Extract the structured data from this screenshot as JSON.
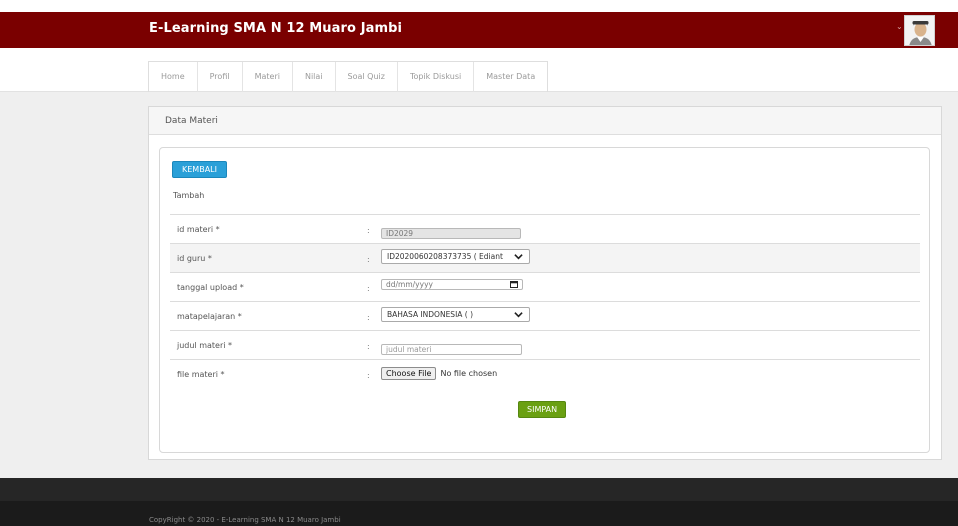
{
  "header": {
    "brand": "E-Learning SMA N 12 Muaro Jambi",
    "user_caret": "⌄"
  },
  "nav": {
    "items": [
      {
        "label": "Home"
      },
      {
        "label": "Profil"
      },
      {
        "label": "Materi"
      },
      {
        "label": "Nilai"
      },
      {
        "label": "Soal Quiz"
      },
      {
        "label": "Topik Diskusi"
      },
      {
        "label": "Master Data"
      }
    ]
  },
  "panel": {
    "title": "Data Materi",
    "back_button": "KEMBALI",
    "subtitle": "Tambah"
  },
  "form": {
    "colon": ":",
    "id_materi": {
      "label": "id materi *",
      "value": "ID2029"
    },
    "id_guru": {
      "label": "id guru *",
      "value": "ID2020060208373735 ( Ediant"
    },
    "tanggal_upload": {
      "label": "tanggal upload *",
      "placeholder": "dd/mm/yyyy"
    },
    "matapelajaran": {
      "label": "matapelajaran *",
      "value": "BAHASA INDONESIA ( )"
    },
    "judul_materi": {
      "label": "judul materi *",
      "placeholder": "judul materi"
    },
    "file_materi": {
      "label": "file materi *",
      "button": "Choose File",
      "status": "No file chosen"
    },
    "submit": "SIMPAN"
  },
  "footer": {
    "copyright": "CopyRight © 2020 - E-Learning SMA N 12 Muaro Jambi"
  },
  "colors": {
    "header_bg": "#7a0000",
    "primary_button": "#2aa0d8",
    "success_button": "#6aa012",
    "footer_bg": "#1b1b1b"
  },
  "icons": [
    "user-avatar-icon",
    "chevron-down-icon",
    "calendar-icon"
  ]
}
